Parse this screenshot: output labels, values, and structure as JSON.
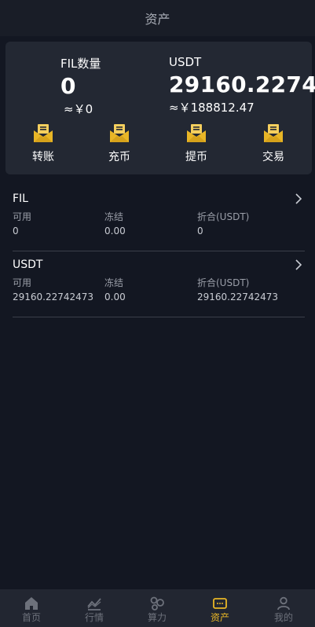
{
  "header": {
    "title": "资产"
  },
  "summary": {
    "fil": {
      "label": "FIL数量",
      "amount": "0",
      "cny": "≈￥0"
    },
    "usdt": {
      "label": "USDT",
      "amount": "29160.2274",
      "cny": "≈￥188812.47"
    },
    "actions": [
      {
        "label": "转账",
        "icon": "envelope-icon"
      },
      {
        "label": "充币",
        "icon": "envelope-icon"
      },
      {
        "label": "提币",
        "icon": "envelope-icon"
      },
      {
        "label": "交易",
        "icon": "envelope-icon"
      }
    ]
  },
  "assets": [
    {
      "name": "FIL",
      "columns": [
        {
          "label": "可用",
          "value": "0"
        },
        {
          "label": "冻结",
          "value": "0.00"
        },
        {
          "label": "折合(USDT)",
          "value": "0"
        }
      ]
    },
    {
      "name": "USDT",
      "columns": [
        {
          "label": "可用",
          "value": "29160.22742473"
        },
        {
          "label": "冻结",
          "value": "0.00"
        },
        {
          "label": "折合(USDT)",
          "value": "29160.22742473"
        }
      ]
    }
  ],
  "tabbar": {
    "active": "资产",
    "items": [
      {
        "label": "首页",
        "icon": "home-icon"
      },
      {
        "label": "行情",
        "icon": "market-chart-icon"
      },
      {
        "label": "算力",
        "icon": "hashrate-icon"
      },
      {
        "label": "资产",
        "icon": "wallet-icon"
      },
      {
        "label": "我的",
        "icon": "user-icon"
      }
    ]
  },
  "colors": {
    "background": "#131722",
    "card": "#232833",
    "accent": "#e9b626",
    "muted": "#9a9ea8"
  }
}
